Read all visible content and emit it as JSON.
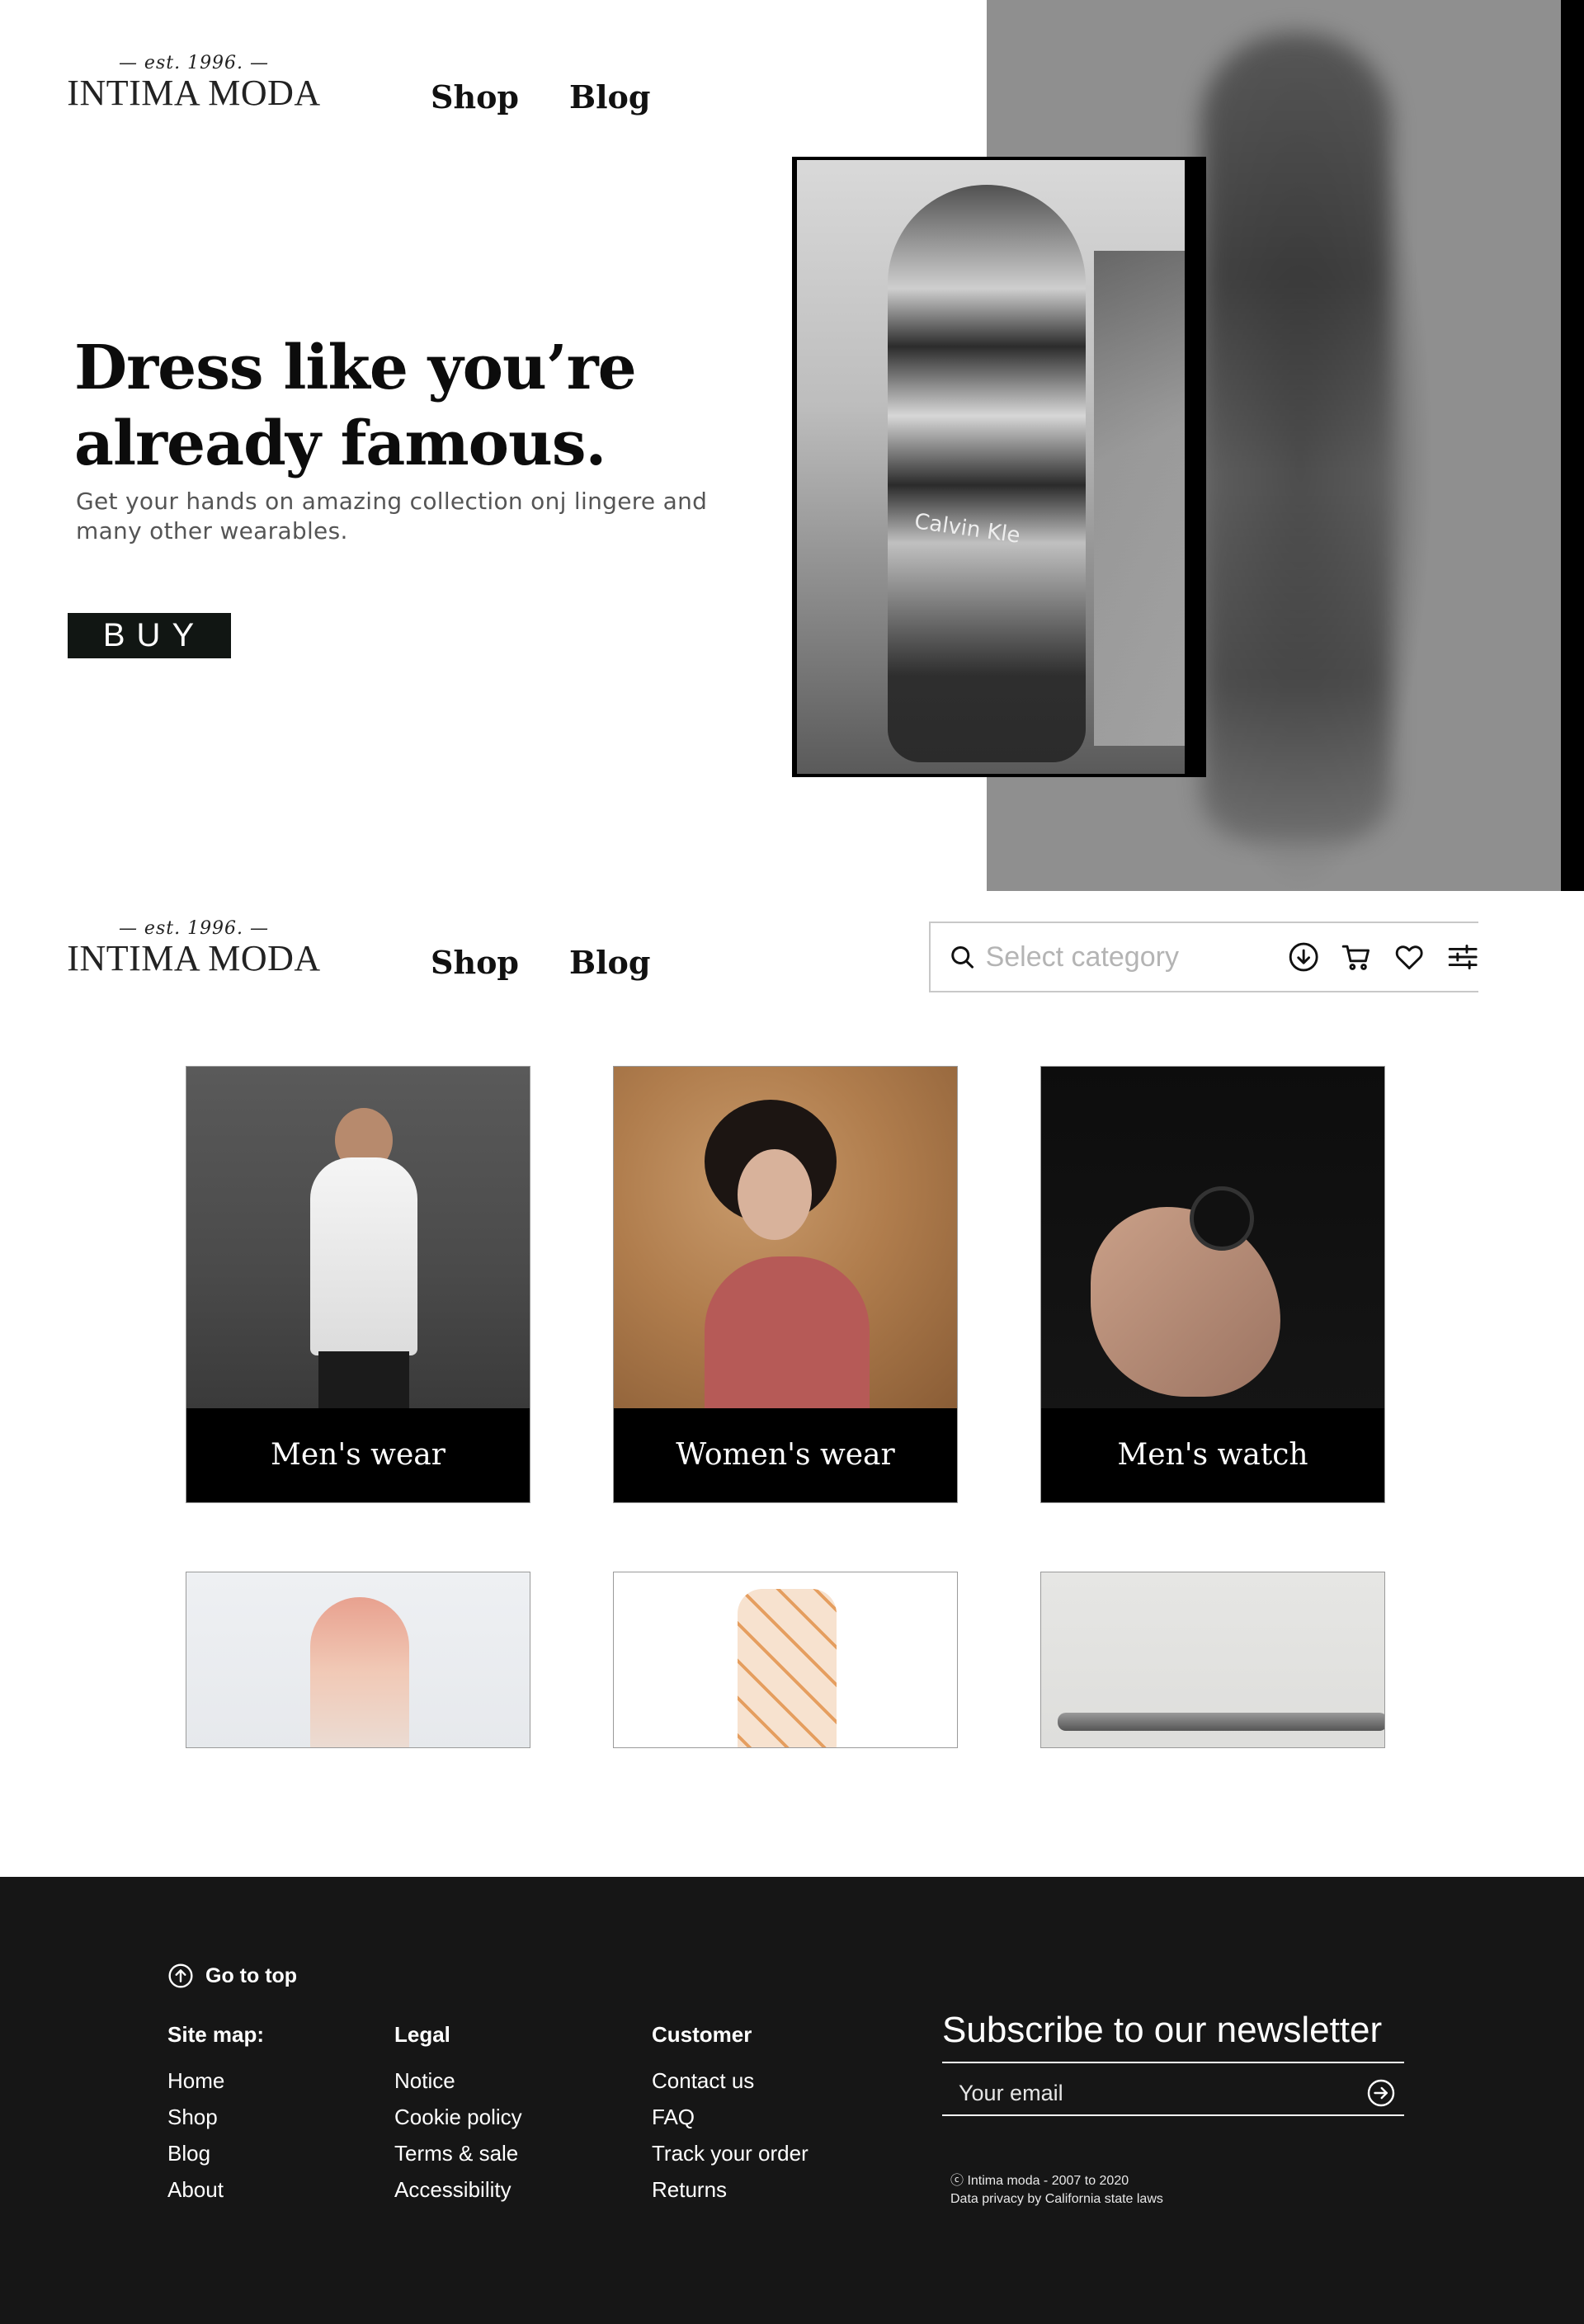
{
  "brand": {
    "est": "— est. 1996. —",
    "name": "INTIMA MODA"
  },
  "nav": {
    "shop": "Shop",
    "blog": "Blog"
  },
  "hero": {
    "title_line1": "Dress like you’re",
    "title_line2": "already famous.",
    "subtitle_line1": "Get your hands on amazing collection onj lingere and",
    "subtitle_line2": "many other wearables.",
    "buy_label": "BUY",
    "photo_brand_text": "Calvin Kle"
  },
  "search": {
    "placeholder": "Select category",
    "value": ""
  },
  "icons": [
    "search-icon",
    "download-icon",
    "cart-icon",
    "heart-icon",
    "filter-icon",
    "arrow-up-circle-icon",
    "arrow-right-circle-icon"
  ],
  "categories": [
    {
      "label": "Men's wear"
    },
    {
      "label": "Women's wear"
    },
    {
      "label": "Men's watch"
    }
  ],
  "footer": {
    "go_top": "Go to top",
    "sitemap": {
      "title": "Site map:",
      "links": [
        "Home",
        "Shop",
        "Blog",
        "About"
      ]
    },
    "legal": {
      "title": "Legal",
      "links": [
        "Notice",
        "Cookie policy",
        "Terms & sale",
        "Accessibility"
      ]
    },
    "customer": {
      "title": "Customer",
      "links": [
        "Contact us",
        "FAQ",
        "Track your order",
        "Returns"
      ]
    },
    "newsletter": {
      "title": "Subscribe to our newsletter",
      "placeholder": "Your email"
    },
    "copyright_line1": "ⓒ Intima moda - 2007 to 2020",
    "copyright_line2": "Data privacy by California state laws"
  },
  "colors": {
    "background": "#ffffff",
    "footer_bg": "#161616",
    "button_bg": "#111613",
    "card_label_bg": "#000000"
  }
}
